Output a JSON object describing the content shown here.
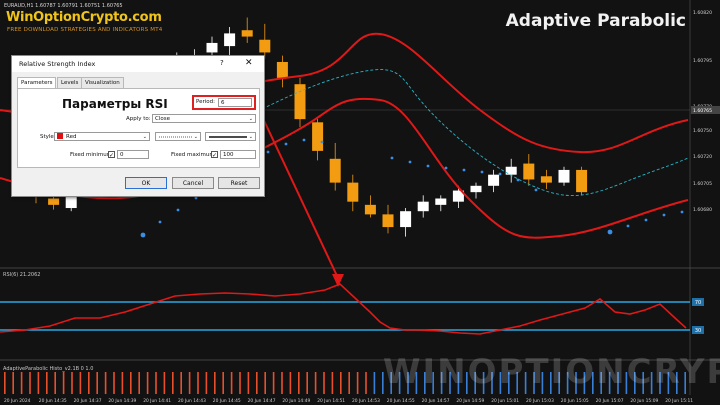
{
  "header": {
    "symbol_line": "EURAUD,H1  1.60787 1.60791 1.60751 1.60765",
    "brand": "WinOptionCrypto.com",
    "tagline": "FREE DOWNLOAD STRATEGIES AND INDICATORS MT4",
    "title": "Adaptive Parabolic"
  },
  "price_axis": {
    "labels": [
      "1.60820",
      "1.60795",
      "1.60770",
      "1.60750",
      "1.60720",
      "1.60705",
      "1.60680"
    ],
    "current": "1.60765"
  },
  "rsi_panel": {
    "label": "RSI(6) 21.2062",
    "levels": [
      "70",
      "30"
    ]
  },
  "indicator2": {
    "label": "AdaptiveParabolic Histo_v2.1B 0 1.0"
  },
  "time_axis": [
    "20 Jun 2024",
    "20 Jun 14:35",
    "20 Jun 14:37",
    "20 Jun 14:39",
    "20 Jun 14:41",
    "20 Jun 14:43",
    "20 Jun 14:45",
    "20 Jun 14:47",
    "20 Jun 14:49",
    "20 Jun 14:51",
    "20 Jun 14:53",
    "20 Jun 14:55",
    "20 Jun 14:57",
    "20 Jun 14:59",
    "20 Jun 15:01",
    "20 Jun 15:03",
    "20 Jun 15:05",
    "20 Jun 15:07",
    "20 Jun 15:09",
    "20 Jun 15:11"
  ],
  "watermark": "WINOPTIONCRYPTO.COM",
  "dialog": {
    "title": "Relative Strength Index",
    "help": "?",
    "close": "✕",
    "tabs": [
      "Parameters",
      "Levels",
      "Visualization"
    ],
    "heading": "Параметры RSI",
    "period_label": "Period:",
    "period_value": "6",
    "apply_label": "Apply to:",
    "apply_value": "Close",
    "style_label": "Style:",
    "style_value": "Red",
    "fixed_min_label": "Fixed minimum",
    "fixed_min_value": "0",
    "fixed_max_label": "Fixed maximum",
    "fixed_max_value": "100",
    "ok": "OK",
    "cancel": "Cancel",
    "reset": "Reset"
  },
  "colors": {
    "bull": "#ffffff",
    "bear": "#f39c12",
    "band": "#e01818",
    "dots": "#3a8ee6",
    "sar": "#2ab6c8",
    "level": "#29a8e0",
    "histo_up": "#3a7fd6",
    "histo_down": "#e8502c"
  },
  "chart_data": {
    "type": "candlestick",
    "candles": [
      {
        "o": 1.60738,
        "h": 1.60742,
        "l": 1.60717,
        "c": 1.60722
      },
      {
        "o": 1.6072,
        "h": 1.60722,
        "l": 1.60713,
        "c": 1.60716
      },
      {
        "o": 1.60714,
        "h": 1.60725,
        "l": 1.60712,
        "c": 1.60722
      },
      {
        "o": 1.60772,
        "h": 1.60782,
        "l": 1.60768,
        "c": 1.60778
      },
      {
        "o": 1.6078,
        "h": 1.6079,
        "l": 1.60776,
        "c": 1.60786
      },
      {
        "o": 1.6079,
        "h": 1.608,
        "l": 1.60786,
        "c": 1.60795
      },
      {
        "o": 1.60795,
        "h": 1.60804,
        "l": 1.6079,
        "c": 1.60798
      },
      {
        "o": 1.608,
        "h": 1.60808,
        "l": 1.60795,
        "c": 1.608
      },
      {
        "o": 1.60802,
        "h": 1.60812,
        "l": 1.60797,
        "c": 1.60806
      },
      {
        "o": 1.60806,
        "h": 1.60814,
        "l": 1.608,
        "c": 1.6081
      },
      {
        "o": 1.60812,
        "h": 1.60822,
        "l": 1.60806,
        "c": 1.60818
      },
      {
        "o": 1.60816,
        "h": 1.60828,
        "l": 1.6081,
        "c": 1.60824
      },
      {
        "o": 1.60826,
        "h": 1.60834,
        "l": 1.60818,
        "c": 1.60822
      },
      {
        "o": 1.6082,
        "h": 1.6083,
        "l": 1.60808,
        "c": 1.60812
      },
      {
        "o": 1.60806,
        "h": 1.6081,
        "l": 1.6079,
        "c": 1.60796
      },
      {
        "o": 1.60792,
        "h": 1.60796,
        "l": 1.60765,
        "c": 1.6077
      },
      {
        "o": 1.60768,
        "h": 1.6077,
        "l": 1.60744,
        "c": 1.6075
      },
      {
        "o": 1.60745,
        "h": 1.60755,
        "l": 1.60725,
        "c": 1.6073
      },
      {
        "o": 1.6073,
        "h": 1.60735,
        "l": 1.60712,
        "c": 1.60718
      },
      {
        "o": 1.60716,
        "h": 1.60722,
        "l": 1.60708,
        "c": 1.6071
      },
      {
        "o": 1.6071,
        "h": 1.60716,
        "l": 1.60698,
        "c": 1.60702
      },
      {
        "o": 1.60702,
        "h": 1.60714,
        "l": 1.60696,
        "c": 1.60712
      },
      {
        "o": 1.60712,
        "h": 1.60722,
        "l": 1.60708,
        "c": 1.60718
      },
      {
        "o": 1.60716,
        "h": 1.60722,
        "l": 1.60712,
        "c": 1.6072
      },
      {
        "o": 1.60718,
        "h": 1.60728,
        "l": 1.60714,
        "c": 1.60725
      },
      {
        "o": 1.60724,
        "h": 1.6073,
        "l": 1.6072,
        "c": 1.60728
      },
      {
        "o": 1.60728,
        "h": 1.60738,
        "l": 1.60724,
        "c": 1.60735
      },
      {
        "o": 1.60735,
        "h": 1.60745,
        "l": 1.6073,
        "c": 1.6074
      },
      {
        "o": 1.60742,
        "h": 1.60748,
        "l": 1.60728,
        "c": 1.60732
      },
      {
        "o": 1.60734,
        "h": 1.60738,
        "l": 1.60726,
        "c": 1.6073
      },
      {
        "o": 1.6073,
        "h": 1.6074,
        "l": 1.60728,
        "c": 1.60738
      },
      {
        "o": 1.60738,
        "h": 1.6074,
        "l": 1.60722,
        "c": 1.60724
      }
    ]
  }
}
